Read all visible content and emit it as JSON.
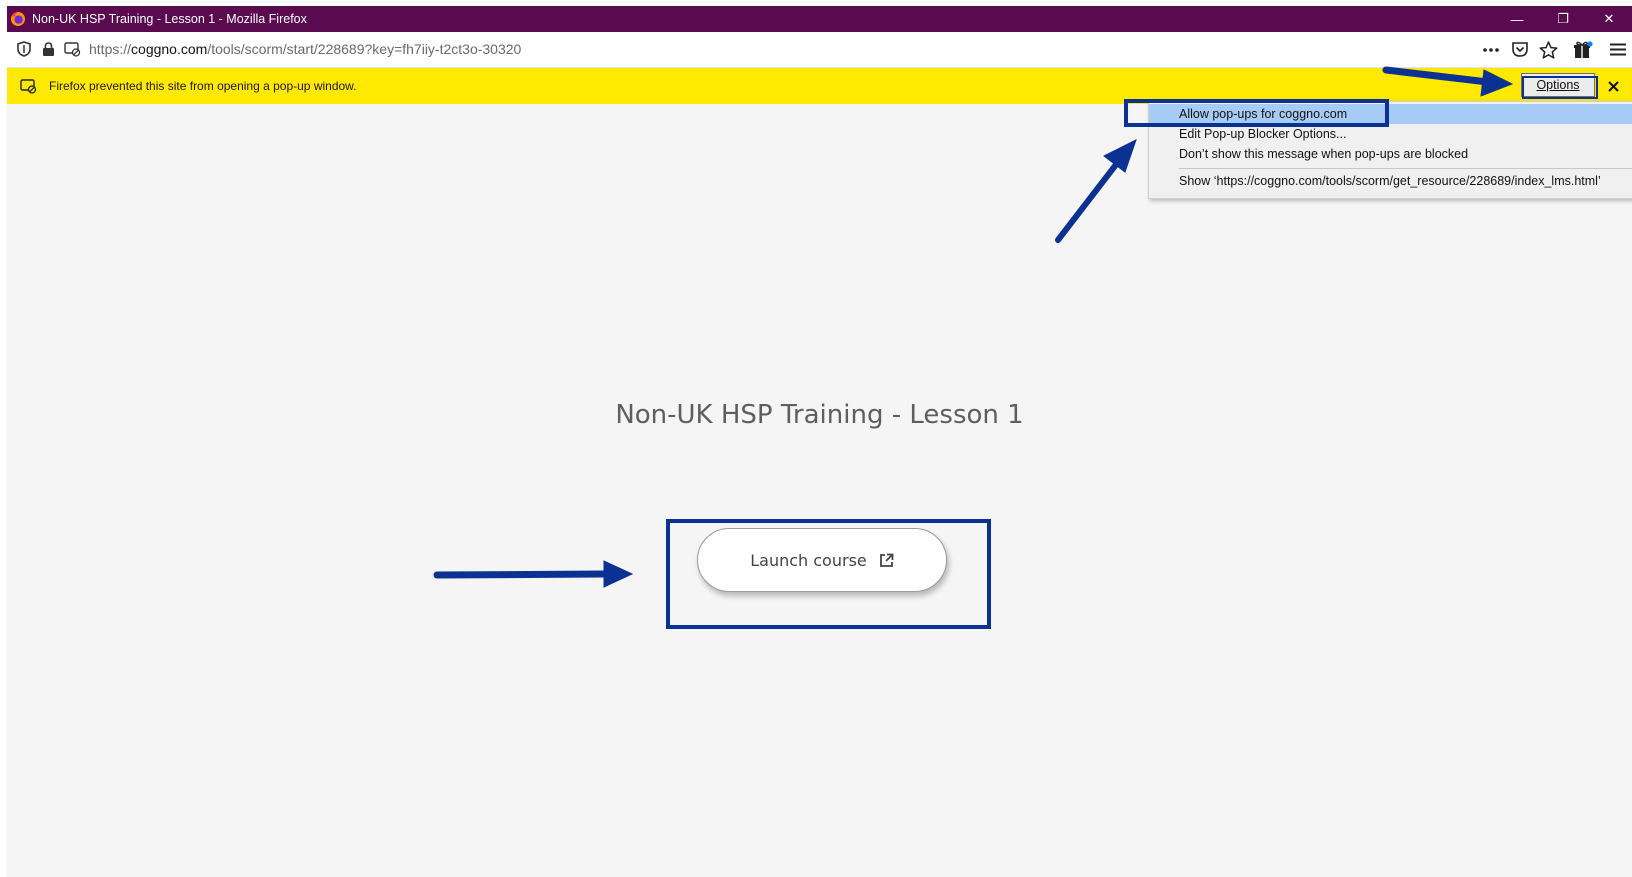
{
  "window": {
    "title": "Non-UK HSP Training - Lesson 1 - Mozilla Firefox",
    "controls": {
      "minimize": "—",
      "restore": "❐",
      "close": "✕"
    }
  },
  "navbar": {
    "url_prefix": "https://",
    "url_domain": "coggno.com",
    "url_path": "/tools/scorm/start/228689?key=fh7iiy-t2ct3o-30320",
    "icons": [
      "shield-icon",
      "lock-icon",
      "permissions-icon",
      "more-icon",
      "pocket-icon",
      "bookmark-star-icon",
      "extensions-icon",
      "menu-icon"
    ]
  },
  "notification": {
    "message": "Firefox prevented this site from opening a pop-up window.",
    "options_label": "Options",
    "color": "#ffe900"
  },
  "popup_menu": {
    "items": [
      "Allow pop-ups for coggno.com",
      "Edit Pop-up Blocker Options...",
      "Don’t show this message when pop-ups are blocked",
      "Show ‘https://coggno.com/tools/scorm/get_resource/228689/index_lms.html’"
    ]
  },
  "page": {
    "title": "Non-UK HSP Training - Lesson 1",
    "launch_label": "Launch course"
  },
  "annotation_color": "#0b3193"
}
